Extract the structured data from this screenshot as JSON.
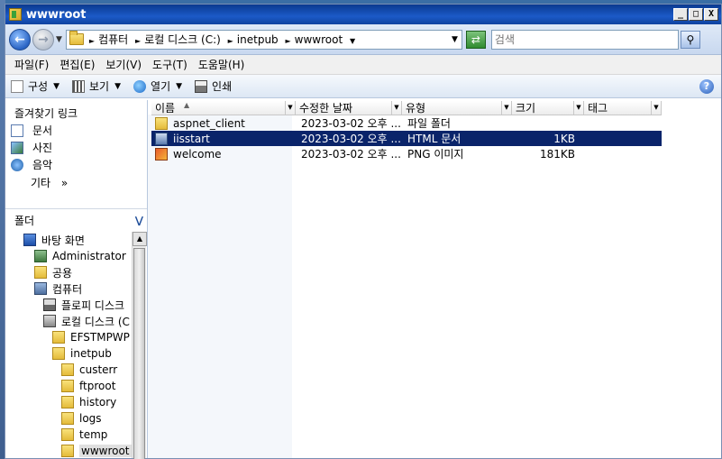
{
  "window": {
    "title": "wwwroot",
    "btn_min": "_",
    "btn_max": "□",
    "btn_close": "X"
  },
  "address": {
    "crumbs": [
      "컴퓨터",
      "로컬 디스크 (C:)",
      "inetpub",
      "wwwroot"
    ],
    "search_placeholder": "검색"
  },
  "menu": [
    "파일(F)",
    "편집(E)",
    "보기(V)",
    "도구(T)",
    "도움말(H)"
  ],
  "toolbar": {
    "organize": "구성",
    "views": "보기",
    "open": "열기",
    "print": "인쇄",
    "help": "?"
  },
  "favorites": {
    "title": "즐겨찾기 링크",
    "items": [
      "문서",
      "사진",
      "음악"
    ],
    "more": "기타",
    "more_chevron": "»"
  },
  "folders": {
    "title": "폴더",
    "tree": [
      {
        "label": "바탕 화면",
        "icon": "desktop-icon",
        "indent": 20
      },
      {
        "label": "Administrator",
        "icon": "user-folder-icon",
        "indent": 32
      },
      {
        "label": "공용",
        "icon": "folder-icon",
        "indent": 32
      },
      {
        "label": "컴퓨터",
        "icon": "computer-icon",
        "indent": 32
      },
      {
        "label": "플로피 디스크",
        "icon": "floppy-icon",
        "indent": 42
      },
      {
        "label": "로컬 디스크 (C",
        "icon": "drive-icon",
        "indent": 42
      },
      {
        "label": "EFSTMPWP",
        "icon": "folder-icon",
        "indent": 52
      },
      {
        "label": "inetpub",
        "icon": "folder-icon",
        "indent": 52
      },
      {
        "label": "custerr",
        "icon": "folder-icon",
        "indent": 62
      },
      {
        "label": "ftproot",
        "icon": "folder-icon",
        "indent": 62
      },
      {
        "label": "history",
        "icon": "folder-icon",
        "indent": 62
      },
      {
        "label": "logs",
        "icon": "folder-icon",
        "indent": 62
      },
      {
        "label": "temp",
        "icon": "folder-icon",
        "indent": 62
      },
      {
        "label": "wwwroot",
        "icon": "folder-icon",
        "indent": 62,
        "selected": true
      }
    ]
  },
  "files": {
    "columns": [
      "이름",
      "수정한 날짜",
      "유형",
      "크기",
      "태그"
    ],
    "rows": [
      {
        "name": "aspnet_client",
        "date": "2023-03-02 오후 ...",
        "type": "파일 폴더",
        "size": "",
        "icon": "folder-icon",
        "selected": false
      },
      {
        "name": "iisstart",
        "date": "2023-03-02 오후 ...",
        "type": "HTML 문서",
        "size": "1KB",
        "icon": "html-file-icon",
        "selected": true
      },
      {
        "name": "welcome",
        "date": "2023-03-02 오후 ...",
        "type": "PNG 이미지",
        "size": "181KB",
        "icon": "png-file-icon",
        "selected": false
      }
    ]
  }
}
